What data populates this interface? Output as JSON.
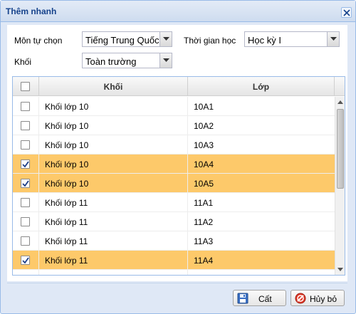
{
  "window": {
    "title": "Thêm nhanh"
  },
  "form": {
    "subject_label": "Môn tự chọn",
    "subject_value": "Tiếng Trung Quốc",
    "period_label": "Thời gian học",
    "period_value": "Học kỳ I",
    "grade_label": "Khối",
    "grade_value": "Toàn trường"
  },
  "grid": {
    "columns": [
      "Khối",
      "Lớp"
    ],
    "rows": [
      {
        "grade": "Khối lớp 10",
        "class": "10A1",
        "checked": false
      },
      {
        "grade": "Khối lớp 10",
        "class": "10A2",
        "checked": false
      },
      {
        "grade": "Khối lớp 10",
        "class": "10A3",
        "checked": false
      },
      {
        "grade": "Khối lớp 10",
        "class": "10A4",
        "checked": true
      },
      {
        "grade": "Khối lớp 10",
        "class": "10A5",
        "checked": true
      },
      {
        "grade": "Khối lớp 11",
        "class": "11A1",
        "checked": false
      },
      {
        "grade": "Khối lớp 11",
        "class": "11A2",
        "checked": false
      },
      {
        "grade": "Khối lớp 11",
        "class": "11A3",
        "checked": false
      },
      {
        "grade": "Khối lớp 11",
        "class": "11A4",
        "checked": true
      },
      {
        "grade": "",
        "class": "",
        "checked": false
      }
    ]
  },
  "buttons": {
    "save_label": "Cất",
    "cancel_label": "Hủy bỏ"
  },
  "colors": {
    "selected_row": "#fdc96a",
    "title_text": "#15428b"
  }
}
